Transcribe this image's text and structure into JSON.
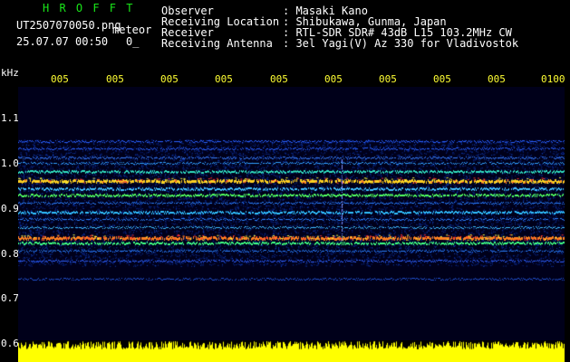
{
  "app": {
    "title": "H R O F F T",
    "filename": "UT2507070050.png",
    "filename_suffix": "meteor",
    "datetime": "25.07.07 00:50",
    "count": "0_"
  },
  "info": {
    "rows": [
      {
        "key": "Observer",
        "value": ": Masaki Kano"
      },
      {
        "key": "Receiving Location",
        "value": ": Shibukawa, Gunma, Japan"
      },
      {
        "key": "Receiver",
        "value": ": RTL-SDR SDR# 43dB L15 103.2MHz CW"
      },
      {
        "key": "Receiving Antenna",
        "value": ": 3el Yagi(V) Az 330 for Vladivostok"
      }
    ]
  },
  "axis": {
    "unit": "kHz",
    "y_ticks": [
      "1.1",
      "1.0",
      "0.9",
      "0.8",
      "0.7",
      "0.6"
    ],
    "x_ticks": [
      "005",
      "005",
      "005",
      "005",
      "005",
      "005",
      "005",
      "005",
      "005",
      "0100"
    ]
  },
  "colors": {
    "title": "#19e619",
    "text": "#ffffff",
    "time_ticks": "#ffff33",
    "amplitude": "#ffff00",
    "background": "#000018"
  }
}
